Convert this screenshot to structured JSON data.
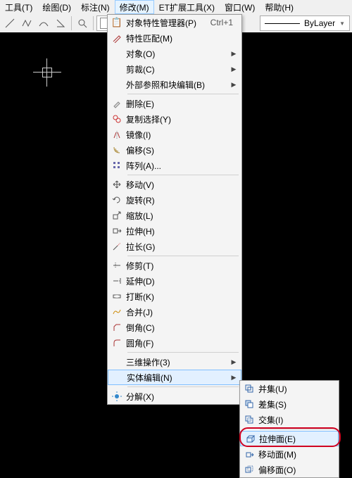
{
  "menubar": {
    "items": [
      "工具(T)",
      "绘图(D)",
      "标注(N)",
      "修改(M)",
      "ET扩展工具(X)",
      "窗口(W)",
      "帮助(H)"
    ],
    "open_index": 3
  },
  "toolbar": {
    "bylayer_label": "ByLayer",
    "linetype_label": "ByLayer"
  },
  "menu": {
    "properties_manager": "对象特性管理器(P)",
    "properties_manager_accel": "Ctrl+1",
    "match_props": "特性匹配(M)",
    "object": "对象(O)",
    "clip": "剪裁(C)",
    "xref_block_edit": "外部参照和块编辑(B)",
    "erase": "删除(E)",
    "copy_sel": "复制选择(Y)",
    "mirror": "镜像(I)",
    "offset": "偏移(S)",
    "array": "阵列(A)...",
    "move": "移动(V)",
    "rotate": "旋转(R)",
    "scale": "缩放(L)",
    "stretch": "拉伸(H)",
    "lengthen": "拉长(G)",
    "trim": "修剪(T)",
    "extend": "延伸(D)",
    "break": "打断(K)",
    "join": "合并(J)",
    "chamfer": "倒角(C)",
    "fillet": "圆角(F)",
    "ops3d": "三维操作(3)",
    "solidedit": "实体编辑(N)",
    "explode": "分解(X)"
  },
  "submenu": {
    "union": "并集(U)",
    "subtract": "差集(S)",
    "intersect": "交集(I)",
    "extrude_face": "拉伸面(E)",
    "move_face": "移动面(M)",
    "offset_face": "偏移面(O)"
  }
}
